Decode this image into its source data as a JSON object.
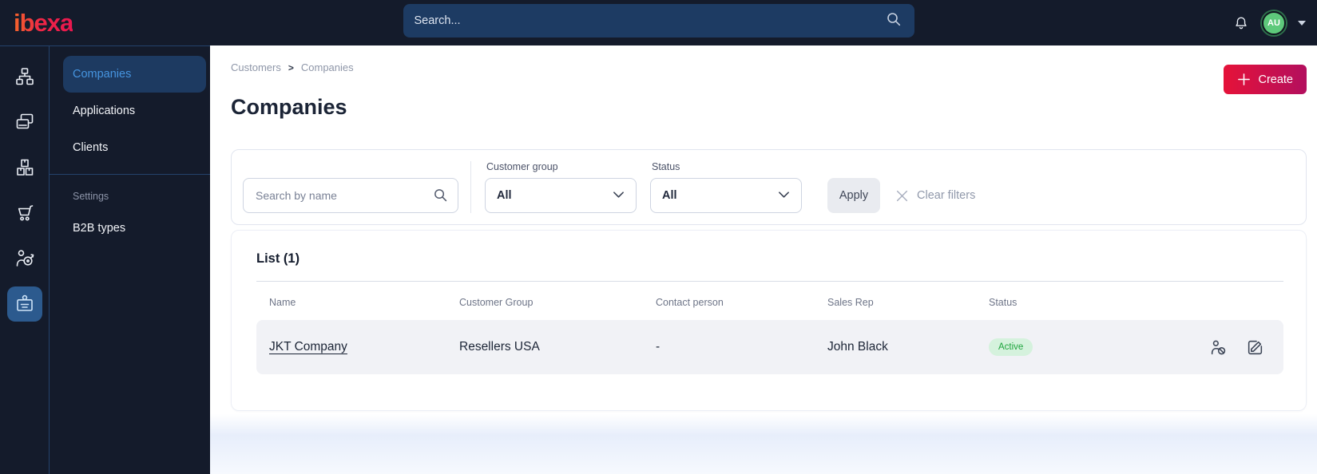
{
  "topbar": {
    "logo": "ibexa",
    "search_placeholder": "Search...",
    "avatar_initials": "AU",
    "icons": [
      "search-icon",
      "bell-icon",
      "caret-down-icon"
    ]
  },
  "sidebar": {
    "rail_icons": [
      "content-tree-icon",
      "pages-icon",
      "products-icon",
      "cart-icon",
      "personalization-icon",
      "customers-badge-icon"
    ],
    "items": [
      {
        "label": "Companies",
        "selected": true
      },
      {
        "label": "Applications",
        "selected": false
      },
      {
        "label": "Clients",
        "selected": false
      }
    ],
    "settings_label": "Settings",
    "settings_items": [
      {
        "label": "B2B types"
      }
    ]
  },
  "breadcrumb": {
    "items": [
      "Customers",
      "Companies"
    ],
    "separator": ">"
  },
  "page": {
    "title": "Companies",
    "create_button": "Create"
  },
  "filters": {
    "search_placeholder": "Search by name",
    "customer_group_label": "Customer group",
    "customer_group_value": "All",
    "status_label": "Status",
    "status_value": "All",
    "apply_button": "Apply",
    "clear_button": "Clear filters"
  },
  "list": {
    "heading": "List (1)",
    "columns": [
      "Name",
      "Customer Group",
      "Contact person",
      "Sales Rep",
      "Status"
    ],
    "rows": [
      {
        "name": "JKT Company",
        "customer_group": "Resellers USA",
        "contact_person": "-",
        "sales_rep": "John Black",
        "status": "Active"
      }
    ],
    "row_action_icons": [
      "deactivate-user-icon",
      "edit-icon"
    ]
  },
  "colors": {
    "dark_bg": "#141b2b",
    "topbar_search_bg": "#1d3b63",
    "selected_nav_bg": "#1d3a61",
    "selected_nav_text": "#4695e0",
    "accent_gradient_from": "#e51239",
    "accent_gradient_to": "#b30f5e",
    "active_badge_bg": "#d5f2dd",
    "active_badge_text": "#1fa53e",
    "row_bg": "#f1f2f6",
    "avatar_bg": "#5ec97b"
  }
}
